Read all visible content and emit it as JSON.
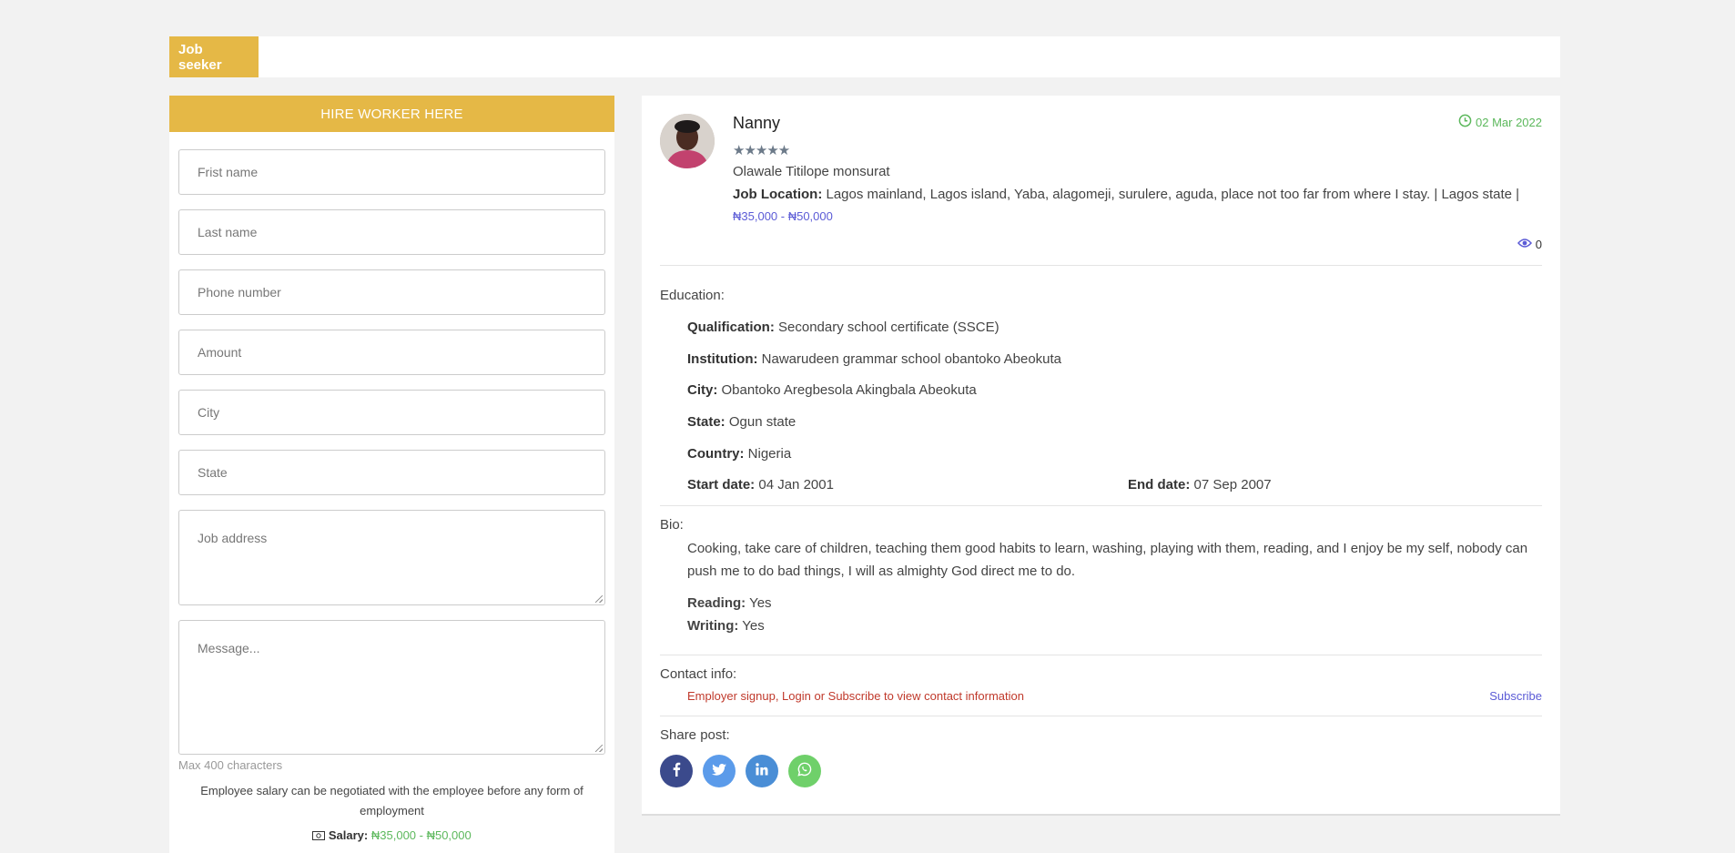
{
  "topbar": {
    "tag": "Job seeker"
  },
  "form": {
    "header": "HIRE WORKER HERE",
    "first_name_placeholder": "Frist name",
    "last_name_placeholder": "Last name",
    "phone_placeholder": "Phone number",
    "amount_placeholder": "Amount",
    "city_placeholder": "City",
    "state_placeholder": "State",
    "job_address_placeholder": "Job address",
    "message_placeholder": "Message...",
    "max_chars": "Max 400 characters",
    "negotiate_note": "Employee salary can be negotiated with the employee before any form of employment",
    "salary_label": "Salary:",
    "salary_value": "₦35,000 - ₦50,000"
  },
  "profile": {
    "title": "Nanny",
    "date": "02 Mar 2022",
    "stars": "★★★★★",
    "name": "Olawale Titilope monsurat",
    "job_location_label": "Job Location:",
    "job_location": "Lagos mainland, Lagos island, Yaba, alagomeji, surulere, aguda, place not too far from where I stay. | Lagos state |",
    "range": "₦35,000 - ₦50,000",
    "views": "0"
  },
  "education": {
    "label": "Education:",
    "qualification_label": "Qualification:",
    "qualification": "Secondary school certificate (SSCE)",
    "institution_label": "Institution:",
    "institution": "Nawarudeen grammar school obantoko Abeokuta",
    "city_label": "City:",
    "city": "Obantoko Aregbesola Akingbala Abeokuta",
    "state_label": "State:",
    "state": "Ogun state",
    "country_label": "Country:",
    "country": "Nigeria",
    "start_label": "Start date:",
    "start": "04 Jan 2001",
    "end_label": "End date:",
    "end": "07 Sep 2007"
  },
  "bio": {
    "label": "Bio:",
    "text": "Cooking, take care of children, teaching them good habits to learn, washing, playing with them, reading, and I enjoy be my self, nobody can push me to do bad things, I will as almighty God direct me to do.",
    "reading_label": "Reading:",
    "reading": "Yes",
    "writing_label": "Writing:",
    "writing": "Yes"
  },
  "contact": {
    "label": "Contact info:",
    "note": "Employer signup, Login or Subscribe to view contact information",
    "subscribe": "Subscribe"
  },
  "share": {
    "label": "Share post:",
    "icons": [
      "facebook-icon",
      "twitter-icon",
      "linkedin-icon",
      "whatsapp-icon"
    ]
  },
  "colors": {
    "accent": "#e5b846",
    "facebook": "#3b4a8c",
    "twitter": "#5b9bea",
    "linkedin": "#4a8ed6",
    "whatsapp": "#6fd06a",
    "green": "#5cb85c",
    "link": "#5b5bd6",
    "alert": "#c0392b"
  }
}
